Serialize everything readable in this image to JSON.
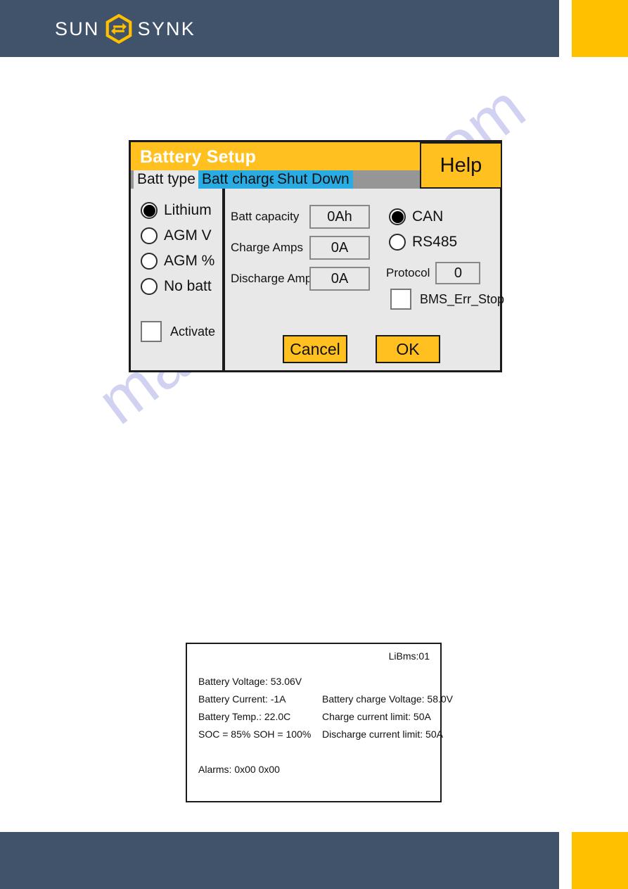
{
  "brand": {
    "word_left": "SUN",
    "word_right": "SYNK",
    "logo_icon": "sunsynk-hex-arrows-icon",
    "navy": "#41526b",
    "yellow": "#ffc000"
  },
  "watermark": {
    "text": "manualshive.com",
    "color": "#c8c8ee"
  },
  "dialog": {
    "title": "Battery Setup",
    "help_label": "Help",
    "accent": "#ffc020",
    "tab_active_bg": "#e8e8e8",
    "tab_inactive_bg": "#29ace3",
    "tabs": [
      {
        "label": "Batt type",
        "active": true
      },
      {
        "label": "Batt charge",
        "active": false
      },
      {
        "label": "Shut Down",
        "active": false
      }
    ],
    "battery_types": [
      {
        "label": "Lithium",
        "selected": true
      },
      {
        "label": "AGM V",
        "selected": false
      },
      {
        "label": "AGM %",
        "selected": false
      },
      {
        "label": "No batt",
        "selected": false
      }
    ],
    "activate": {
      "label": "Activate",
      "checked": false
    },
    "fields": [
      {
        "label": "Batt capacity",
        "value": "0Ah"
      },
      {
        "label": "Charge Amps",
        "value": "0A"
      },
      {
        "label": "Discharge Amps",
        "value": "0A"
      }
    ],
    "comms": [
      {
        "label": "CAN",
        "selected": true
      },
      {
        "label": "RS485",
        "selected": false
      }
    ],
    "protocol": {
      "label": "Protocol",
      "value": "0"
    },
    "bms_err_stop": {
      "label": "BMS_Err_Stop",
      "checked": false
    },
    "buttons": {
      "cancel": "Cancel",
      "ok": "OK"
    }
  },
  "bms_info": {
    "device_label": "LiBms:01",
    "left_lines": [
      "Battery Voltage: 53.06V",
      "Battery Current: -1A",
      "Battery Temp.: 22.0C",
      "SOC = 85%   SOH = 100%"
    ],
    "right_lines": [
      "Battery charge Voltage: 58.0V",
      "Charge current limit: 50A",
      "Discharge current limit: 50A"
    ],
    "alarms": "Alarms: 0x00   0x00"
  }
}
